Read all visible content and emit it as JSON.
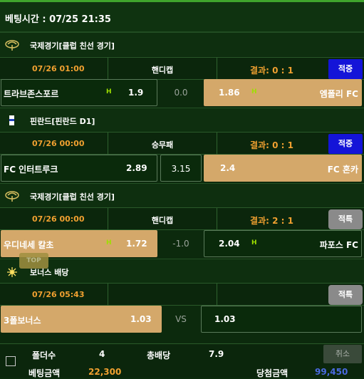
{
  "header": {
    "bet_time": "베팅시간 : 07/25 21:35"
  },
  "games": [
    {
      "league": {
        "label": "국제경기[클럽 친선 경기]",
        "icon": "globe-icon"
      },
      "date": "07/26 01:00",
      "type": "핸디캡",
      "result": "결과: 0 : 1",
      "status": "적중",
      "home": {
        "name": "트라브존스포르",
        "odds": "1.9",
        "marker": "H"
      },
      "middle": "0.0",
      "away": {
        "name": "엠폴리 FC",
        "odds": "1.86",
        "marker": "H"
      }
    },
    {
      "league": {
        "label": "핀란드[핀란드 D1]",
        "icon": "finland-flag-icon"
      },
      "date": "07/26 00:00",
      "type": "승무패",
      "result": "결과: 0 : 1",
      "status": "적중",
      "home": {
        "name": "FC 인터트루크",
        "odds": "2.89"
      },
      "middle": "3.15",
      "away": {
        "name": "FC 혼카",
        "odds": "2.4"
      }
    },
    {
      "league": {
        "label": "국제경기[클럽 친선 경기]",
        "icon": "globe-icon"
      },
      "date": "07/26 00:00",
      "type": "핸디캡",
      "result": "결과: 2 : 1",
      "status": "적특",
      "home": {
        "name": "우디네세 칼초",
        "odds": "1.72",
        "marker": "H"
      },
      "middle": "-1.0",
      "away": {
        "name": "파포스 FC",
        "odds": "2.04",
        "marker": "H"
      }
    },
    {
      "league": {
        "label": "보너스 배당",
        "icon": "bonus-sparkle-icon"
      },
      "date": "07/26 05:43",
      "type": "",
      "result": "",
      "status": "적특",
      "home": {
        "name": "3폴보너스",
        "odds": "1.03"
      },
      "middle": "VS",
      "away": {
        "name": "",
        "odds": "1.03"
      }
    }
  ],
  "top_button": "TOP",
  "footer": {
    "folder_label": "폴더수",
    "folder_value": "4",
    "total_odds_label": "총배당",
    "total_odds_value": "7.9",
    "bet_amount_label": "베팅금액",
    "bet_amount_value": "22,300",
    "win_amount_label": "당첨금액",
    "win_amount_value": "99,450",
    "cancel_label": "취소"
  },
  "colors": {
    "background": "#0c2a0d",
    "accent": "#f0a030",
    "selected": "#d4a86a",
    "status_blue": "#1414d8",
    "status_gray": "#8a8a8a"
  }
}
